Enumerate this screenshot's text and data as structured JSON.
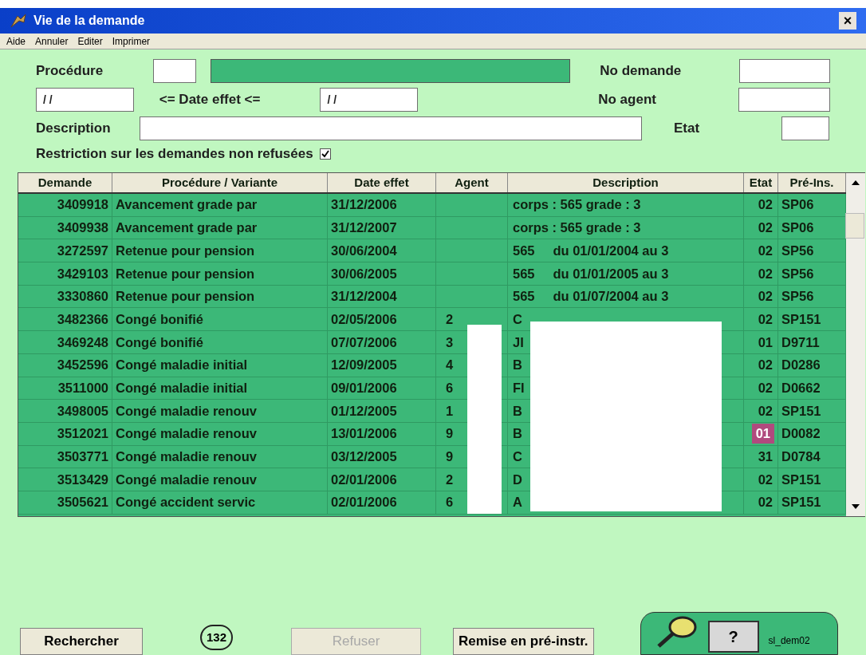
{
  "window": {
    "title": "Vie de la demande",
    "close": "×"
  },
  "menu": [
    "Aide",
    "Annuler",
    "Editer",
    "Imprimer"
  ],
  "filters": {
    "procedure_label": "Procédure",
    "no_demande_label": "No demande",
    "date_from": "/ /",
    "date_label": "<= Date effet <=",
    "date_to": "/ /",
    "no_agent_label": "No agent",
    "description_label": "Description",
    "etat_label": "Etat",
    "restriction_label": "Restriction sur les demandes non refusées",
    "restriction_checked": true
  },
  "table": {
    "columns": [
      "Demande",
      "Procédure / Variante",
      "Date effet",
      "Agent",
      "Description",
      "Etat",
      "Pré-Ins."
    ],
    "rows": [
      {
        "demande": "3409918",
        "procedure": "Avancement grade par",
        "date": "31/12/2006",
        "agent": "",
        "description": "corps : 565 grade : 3",
        "etat": "02",
        "etat_highlighted": false,
        "preins": "SP06"
      },
      {
        "demande": "3409938",
        "procedure": "Avancement grade par",
        "date": "31/12/2007",
        "agent": "",
        "description": "corps : 565 grade : 3",
        "etat": "02",
        "etat_highlighted": false,
        "preins": "SP06"
      },
      {
        "demande": "3272597",
        "procedure": "Retenue pour pension",
        "date": "30/06/2004",
        "agent": "",
        "description": "565     du 01/01/2004 au 3",
        "etat": "02",
        "etat_highlighted": false,
        "preins": "SP56"
      },
      {
        "demande": "3429103",
        "procedure": "Retenue pour pension",
        "date": "30/06/2005",
        "agent": "",
        "description": "565     du 01/01/2005 au 3",
        "etat": "02",
        "etat_highlighted": false,
        "preins": "SP56"
      },
      {
        "demande": "3330860",
        "procedure": "Retenue pour pension",
        "date": "31/12/2004",
        "agent": "",
        "description": "565     du 01/07/2004 au 3",
        "etat": "02",
        "etat_highlighted": false,
        "preins": "SP56"
      },
      {
        "demande": "3482366",
        "procedure": "Congé bonifié",
        "date": "02/05/2006",
        "agent": "2",
        "description": "C",
        "etat": "02",
        "etat_highlighted": false,
        "preins": "SP151"
      },
      {
        "demande": "3469248",
        "procedure": "Congé bonifié",
        "date": "07/07/2006",
        "agent": "3",
        "description": "JI",
        "etat": "01",
        "etat_highlighted": false,
        "preins": "D9711"
      },
      {
        "demande": "3452596",
        "procedure": "Congé maladie initial",
        "date": "12/09/2005",
        "agent": "4",
        "description": "B",
        "etat": "02",
        "etat_highlighted": false,
        "preins": "D0286"
      },
      {
        "demande": "3511000",
        "procedure": "Congé maladie initial",
        "date": "09/01/2006",
        "agent": "6",
        "description": "FI",
        "etat": "02",
        "etat_highlighted": false,
        "preins": "D0662"
      },
      {
        "demande": "3498005",
        "procedure": "Congé maladie renouv",
        "date": "01/12/2005",
        "agent": "1",
        "description": "B",
        "etat": "02",
        "etat_highlighted": false,
        "preins": "SP151"
      },
      {
        "demande": "3512021",
        "procedure": "Congé maladie renouv",
        "date": "13/01/2006",
        "agent": "9",
        "description": "B",
        "etat": "01",
        "etat_highlighted": true,
        "preins": "D0082"
      },
      {
        "demande": "3503771",
        "procedure": "Congé maladie renouv",
        "date": "03/12/2005",
        "agent": "9",
        "description": "C",
        "etat": "31",
        "etat_highlighted": false,
        "preins": "D0784"
      },
      {
        "demande": "3513429",
        "procedure": "Congé maladie renouv",
        "date": "02/01/2006",
        "agent": "2",
        "description": "D",
        "etat": "02",
        "etat_highlighted": false,
        "preins": "SP151"
      },
      {
        "demande": "3505621",
        "procedure": "Congé accident servic",
        "date": "02/01/2006",
        "agent": "6",
        "description": "A",
        "etat": "02",
        "etat_highlighted": false,
        "preins": "SP151"
      }
    ]
  },
  "footer": {
    "search_button": "Rechercher",
    "count": "132",
    "refuse_button": "Refuser",
    "refuse_disabled": true,
    "reset_button": "Remise en pré-instr.",
    "help_button": "?",
    "screen_id": "sl_dem02"
  }
}
